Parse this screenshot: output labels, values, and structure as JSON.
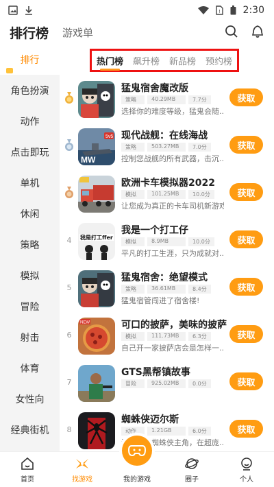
{
  "status": {
    "time": "2:30"
  },
  "header": {
    "title": "排行榜",
    "subtitle": "游戏单"
  },
  "sidebar": {
    "items": [
      "排行",
      "角色扮演",
      "动作",
      "点击即玩",
      "单机",
      "休闲",
      "策略",
      "模拟",
      "冒险",
      "射击",
      "体育",
      "女性向",
      "经典街机"
    ]
  },
  "tabs": [
    "热门榜",
    "飙升榜",
    "新品榜",
    "预约榜"
  ],
  "get_label": "获取",
  "apps": [
    {
      "rank": "1",
      "name": "猛鬼宿舍魔改版",
      "category": "策略",
      "size": "40.29MB",
      "rating": "7.7分",
      "desc": "选择你的难度等级，猛鬼会随...",
      "icon": "ghost-dorm-game-icon"
    },
    {
      "rank": "2",
      "name": "现代战舰：在线海战",
      "category": "策略",
      "size": "503.27MB",
      "rating": "7.0分",
      "desc": "控制您战舰的所有武器，击沉...",
      "icon": "modern-warships-game-icon"
    },
    {
      "rank": "3",
      "name": "欧洲卡车模拟器2022",
      "category": "模拟",
      "size": "101.25MB",
      "rating": "10.0分",
      "desc": "让您成为真正的卡车司机新游戏",
      "icon": "euro-truck-game-icon"
    },
    {
      "rank": "4",
      "name": "我是一个打工仔",
      "category": "模拟",
      "size": "8.9MB",
      "rating": "10.0分",
      "desc": "平凡的打工生涯，只为成就对...",
      "icon": "worker-game-icon"
    },
    {
      "rank": "5",
      "name": "猛鬼宿舍：绝望模式",
      "category": "策略",
      "size": "36.61MB",
      "rating": "8.4分",
      "desc": "猛鬼宿管闯进了宿舍楼!",
      "icon": "ghost-dorm-despair-game-icon"
    },
    {
      "rank": "6",
      "name": "可口的披萨，美味的披萨",
      "category": "模拟",
      "size": "111.73MB",
      "rating": "6.3分",
      "desc": "自己开一家披萨店会是怎样一...",
      "icon": "pizza-game-icon"
    },
    {
      "rank": "7",
      "name": "GTS黑帮镇故事",
      "category": "冒险",
      "size": "925.02MB",
      "rating": "0.0分",
      "desc": "",
      "icon": "gangster-town-game-icon"
    },
    {
      "rank": "8",
      "name": "蜘蛛侠迈尔斯",
      "category": "动作",
      "size": "1.21GB",
      "rating": "6.0分",
      "desc": "沉浸漫威蜘蛛侠主角，在超庞...",
      "icon": "spider-man-game-icon"
    }
  ],
  "bottom_nav": [
    "首页",
    "找游戏",
    "我的游戏",
    "圈子",
    "个人"
  ],
  "colors": {
    "accent": "#ff9c12",
    "highlight_box": "#e11"
  }
}
